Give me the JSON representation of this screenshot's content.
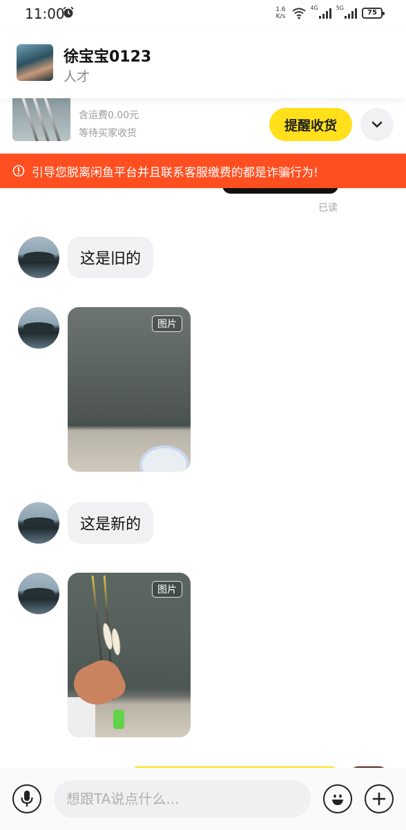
{
  "status_bar": {
    "time": "11:00",
    "net_speed_value": "1.6",
    "net_speed_unit": "K/s",
    "signal_1_label": "4G",
    "signal_2_label": "5G",
    "battery": "75"
  },
  "header": {
    "contact_name": "徐宝宝0123",
    "contact_subtitle": "人才"
  },
  "order": {
    "shipping_text": "含运费0.00元",
    "status_text": "等待买家收货",
    "remind_button_label": "提醒收货"
  },
  "warning": {
    "text": "引导您脱离闲鱼平台并且联系客服缴费的都是诈骗行为!"
  },
  "chat": {
    "read_status": "已读",
    "messages": [
      {
        "type": "text",
        "text": "这是旧的"
      },
      {
        "type": "image",
        "tag": "图片"
      },
      {
        "type": "text",
        "text": "这是新的"
      },
      {
        "type": "image",
        "tag": "图片"
      }
    ]
  },
  "input_bar": {
    "placeholder": "想跟TA说点什么..."
  }
}
